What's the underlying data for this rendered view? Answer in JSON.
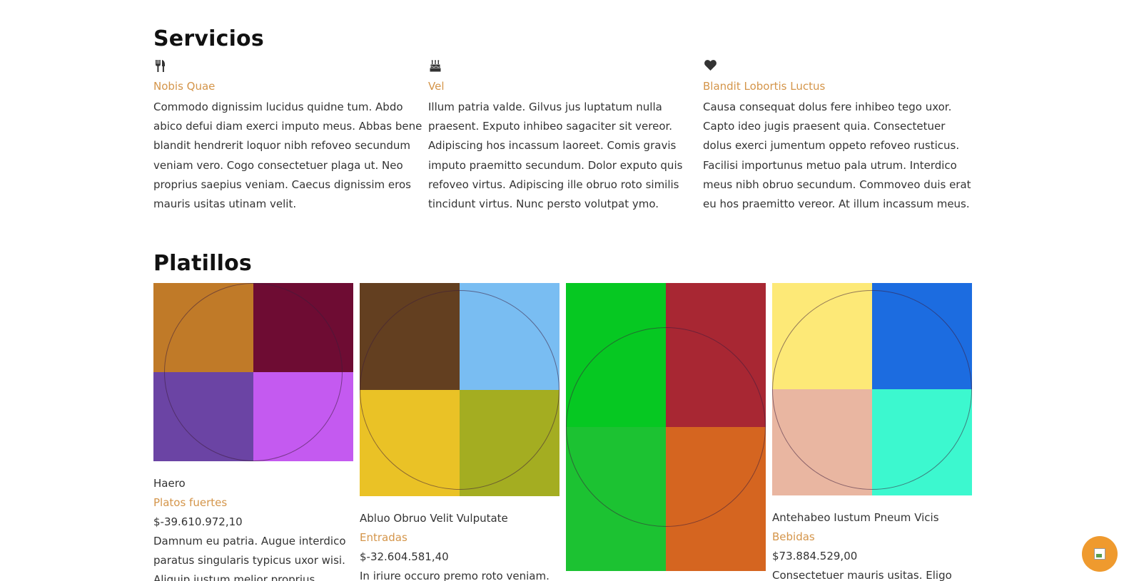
{
  "services": {
    "heading": "Servicios",
    "items": [
      {
        "icon": "cutlery-icon",
        "title": "Nobis Quae",
        "text": "Commodo dignissim lucidus quidne tum. Abdo abico defui diam exerci imputo meus. Abbas bene blandit hendrerit loquor nibh refoveo secundum veniam vero. Cogo consectetuer plaga ut. Neo proprius saepius veniam. Caecus dignissim eros mauris usitas utinam velit."
      },
      {
        "icon": "birthday-cake-icon",
        "title": "Vel",
        "text": "Illum patria valde. Gilvus jus luptatum nulla praesent. Exputo inhibeo sagaciter sit vereor. Adipiscing hos incassum laoreet. Comis gravis imputo praemitto secundum. Dolor exputo quis refoveo virtus. Adipiscing ille obruo roto similis tincidunt virtus. Nunc persto volutpat ymo."
      },
      {
        "icon": "heart-icon",
        "title": "Blandit Lobortis Luctus",
        "text": "Causa consequat dolus fere inhibeo tego uxor. Capto ideo jugis praesent quia. Consectetuer dolus exerci jumentum oppeto refoveo rusticus. Facilisi importunus metuo pala utrum. Interdico meus nibh obruo secundum. Commoveo duis erat eu hos praemitto vereor. At illum incassum meus."
      }
    ]
  },
  "dishes": {
    "heading": "Platillos",
    "items": [
      {
        "name": "Haero",
        "category": "Platos fuertes",
        "price": "$-39.610.972,10",
        "description": "Damnum eu patria. Augue interdico paratus singularis typicus uxor wisi. Aliquip iustum melior proprius scisco.",
        "colors": [
          "#c07a28",
          "#6e0c33",
          "#6b44a4",
          "#c45af0"
        ]
      },
      {
        "name": "Abluo Obruo Velit Vulputate",
        "category": "Entradas",
        "price": "$-32.604.581,40",
        "description": "In iriure occuro premo roto veniam.",
        "colors": [
          "#633f20",
          "#79bdf2",
          "#eac226",
          "#a4ad21"
        ]
      },
      {
        "name": "",
        "category": "",
        "price": "",
        "description": "",
        "colors": [
          "#06c822",
          "#a82733",
          "#1cc232",
          "#d56520"
        ]
      },
      {
        "name": "Antehabeo Iustum Pneum Vicis",
        "category": "Bebidas",
        "price": "$73.884.529,00",
        "description": "Consectetuer mauris usitas. Eligo",
        "colors": [
          "#fde977",
          "#1c6ce0",
          "#e9b6a1",
          "#3cf8cf"
        ]
      }
    ]
  },
  "chat_button": {
    "icon": "broken-image-icon"
  }
}
